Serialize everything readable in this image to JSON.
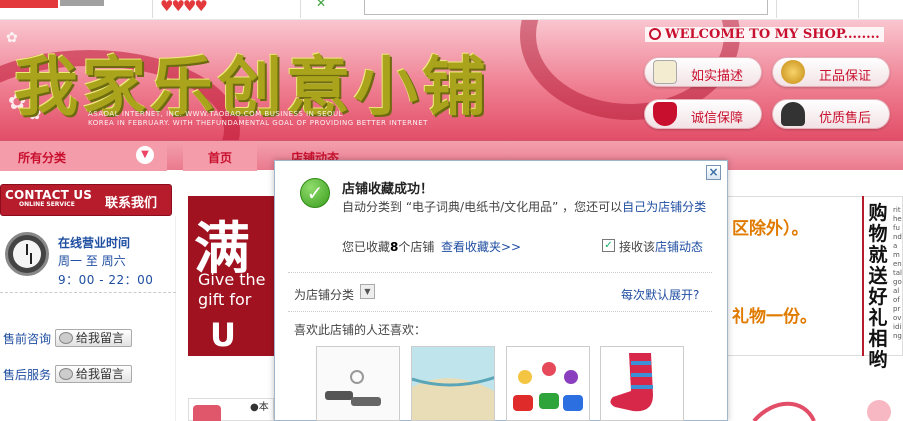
{
  "shop": {
    "title": "我家乐创意小铺",
    "tagline_1": "ASADAL INTERNET, INC. WWW.TAOBAO.COM BUSINESS IN SEOUL",
    "tagline_2": "KOREA IN FEBRUARY. WITH THEFUNDAMENTAL GOAL OF PROVIDING BETTER INTERNET",
    "welcome": "WELCOME TO MY SHOP........",
    "badges": [
      "如实描述",
      "正品保证",
      "诚信保障",
      "优质售后"
    ]
  },
  "nav": {
    "all_categories": "所有分类",
    "tabs": [
      "首页",
      "店铺动态"
    ]
  },
  "sidebar": {
    "contact_en": "CONTACT US",
    "contact_sub": "ONLINE SERVICE",
    "contact_cn": "联系我们",
    "hours_title": "在线营业时间",
    "hours_days": "周一 至 周六",
    "hours_time": "9：00 - 22：00",
    "presale_label": "售前咨询",
    "aftersale_label": "售后服务",
    "message_button": "给我留言"
  },
  "promo": {
    "big_char": "满",
    "en_line1": "Give the",
    "en_line2": "gift for",
    "en_u": "U",
    "text_1": "区除外）。",
    "text_2": "礼物一份。",
    "vertical": "购物就送好礼相哟",
    "vertical_small": "rithefundamental goal of providing"
  },
  "popup": {
    "title": "店铺收藏成功！",
    "line1_prefix": "自动分类到 “电子词典/电纸书/文化用品” ，您还可以",
    "line1_link": "自己为店铺分类",
    "count_prefix": "您已收藏",
    "count": "8",
    "count_suffix": "个店铺",
    "view_link": "查看收藏夹>>",
    "receive_label": "接收该",
    "receive_link": "店铺动态",
    "category_label": "为店铺分类",
    "expand_link": "每次默认展开?",
    "also_like": "喜欢此店铺的人还喜欢："
  },
  "bottom": {
    "dot_text": "●本"
  },
  "colors": {
    "brand_red": "#c8102e",
    "link_blue": "#1f4ea1",
    "banner_pink": "#ef7f92",
    "title_olive": "#a9a41c"
  }
}
